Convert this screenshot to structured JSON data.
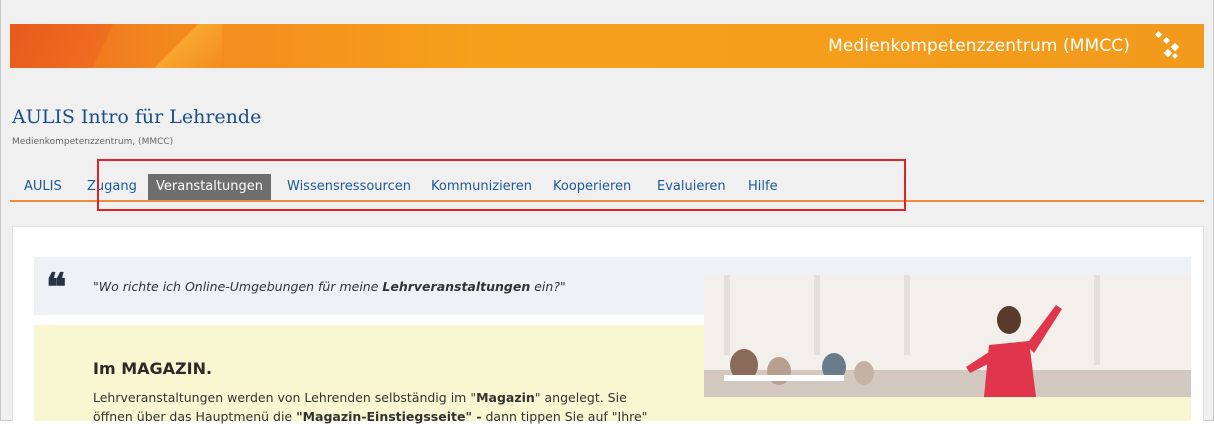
{
  "header": {
    "brand": "Medienkompetenzzentrum (MMCC)",
    "logo_icon": "mmcc-logo-icon"
  },
  "page": {
    "title": "AULIS Intro für Lehrende",
    "subtitle": "Medienkompetenzzentrum, (MMCC)"
  },
  "tabs": [
    {
      "label": "AULIS",
      "active": false
    },
    {
      "label": "Zugang",
      "active": false
    },
    {
      "label": "Veranstaltungen",
      "active": true
    },
    {
      "label": "Wissensressourcen",
      "active": false
    },
    {
      "label": "Kommunizieren",
      "active": false
    },
    {
      "label": "Kooperieren",
      "active": false
    },
    {
      "label": "Evaluieren",
      "active": false
    },
    {
      "label": "Hilfe",
      "active": false
    }
  ],
  "quote": {
    "icon": "quote-icon",
    "prefix": "\"Wo richte ich Online-Umgebungen für meine ",
    "bold": "Lehrveranstaltungen",
    "suffix": " ein?\""
  },
  "magazine": {
    "title": "Im MAGAZIN.",
    "line1_a": "Lehrveranstaltungen werden von Lehrenden selbständig im \"",
    "line1_b": "Magazin",
    "line1_c": "\" angelegt. Sie",
    "line2_a": "öffnen über das Hauptmenü die ",
    "line2_b": "\"Magazin-Einstiegsseite\" -",
    "line2_c": " dann tippen Sie auf \"Ihre\""
  },
  "colors": {
    "brand_orange": "#f28a1e",
    "title_blue": "#1a4e86",
    "active_tab": "#6e6e6e",
    "highlight_red": "#e0202a",
    "magazine_bg": "#f8f7d2"
  }
}
